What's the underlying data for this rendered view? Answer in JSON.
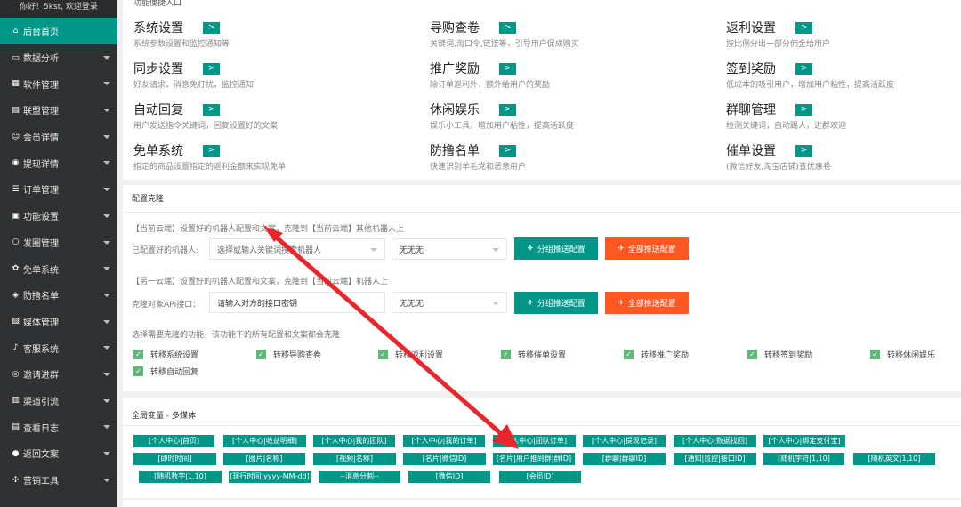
{
  "sidebar": {
    "greeting": "你好！5kst, 欢迎登录",
    "items": [
      {
        "label": "后台首页",
        "icon": "⌂"
      },
      {
        "label": "数据分析",
        "icon": "▭"
      },
      {
        "label": "软件管理",
        "icon": "▦"
      },
      {
        "label": "联盟管理",
        "icon": "▤"
      },
      {
        "label": "会员详情",
        "icon": "☺"
      },
      {
        "label": "提现详情",
        "icon": "◉"
      },
      {
        "label": "订单管理",
        "icon": "☰"
      },
      {
        "label": "功能设置",
        "icon": "▣"
      },
      {
        "label": "发圈管理",
        "icon": "○"
      },
      {
        "label": "免单系统",
        "icon": "✿"
      },
      {
        "label": "防撸名单",
        "icon": "◈"
      },
      {
        "label": "媒体管理",
        "icon": "▧"
      },
      {
        "label": "客服系统",
        "icon": "♪"
      },
      {
        "label": "邀请进群",
        "icon": "◎"
      },
      {
        "label": "渠道引流",
        "icon": "▥"
      },
      {
        "label": "查看日志",
        "icon": "▤"
      },
      {
        "label": "返回文案",
        "icon": "●"
      },
      {
        "label": "营销工具",
        "icon": "✣"
      }
    ]
  },
  "features": {
    "hint": "功能便捷入口",
    "items": [
      {
        "title": "系统设置",
        "desc": "系统参数设置和监控通知等"
      },
      {
        "title": "导购查卷",
        "desc": "关键词,淘口令,链接等，引导用户促成购买"
      },
      {
        "title": "返利设置",
        "desc": "按比例分出一部分佣金给用户"
      },
      {
        "title": "同步设置",
        "desc": "好友请求，消息免打扰，监控通知"
      },
      {
        "title": "推广奖励",
        "desc": "除订单返利外，额外给用户的奖励"
      },
      {
        "title": "签到奖励",
        "desc": "低成本的吸引用户，增加用户粘性，提高活跃度"
      },
      {
        "title": "自动回复",
        "desc": "用户发送指令关键词，回复设置好的文案"
      },
      {
        "title": "休闲娱乐",
        "desc": "娱乐小工具，增加用户粘性，提高活跃度"
      },
      {
        "title": "群聊管理",
        "desc": "检测关键词，自动踢人，进群欢迎"
      },
      {
        "title": "免单系统",
        "desc": "指定的商品设置指定的返利金额来实现免单"
      },
      {
        "title": "防撸名单",
        "desc": "快速识别羊毛党和恶意用户"
      },
      {
        "title": "催单设置",
        "desc": "(微信好友,淘宝店铺)查优惠卷"
      }
    ]
  },
  "clone": {
    "title": "配置克隆",
    "desc1": "【当前云端】设置好的机器人配置和文案，克隆到【当前云端】其他机器人上",
    "label1": "已配置好的机器人:",
    "select1_placeholder": "选择或输入关键词搜索机器人",
    "select2_value": "无无无",
    "btn_group": "分组推送配置",
    "btn_all": "全部推送配置",
    "desc2": "【另一云端】设置好的机器人配置和文案，克隆到【当前云端】机器人上",
    "label2": "克隆对象API接口：",
    "api_placeholder": "请输入对方的接口密钥",
    "select3_value": "无无无",
    "desc3": "选择需要克隆的功能，该功能下的所有配置和文案都会克隆",
    "checks": [
      "转移系统设置",
      "转移导购查卷",
      "转移返利设置",
      "转移催单设置",
      "转移推广奖励",
      "转移签到奖励",
      "转移休闲娱乐",
      "转移自动回复"
    ]
  },
  "vars": {
    "title": "全局变量 - 多媒体",
    "tags": [
      "[个人中心|首页]",
      "[个人中心|收益明细]",
      "[个人中心|我的团队]",
      "[个人中心|我的订单]",
      "[个人中心|团队订单]",
      "[个人中心|提现记录]",
      "[个人中心|数据找回]",
      "[个人中心|绑定支付宝]",
      "[即时时间]",
      "[图片|名称]",
      "[视频|名称]",
      "[名片|微信ID]",
      "[名片|用户推到群|群ID]",
      "[群聊|群聊ID]",
      "[通知|监控|接口ID]",
      "[随机字符|1,10]",
      "[随机英文|1,10]",
      "[随机数字|1,10]",
      "[现行时间|yyyy-MM-dd]",
      "--消息分割--",
      "[微信ID]",
      "[会员ID]"
    ]
  },
  "colors": {
    "accent": "#009688",
    "orange": "#ff5722",
    "sidebar": "#2f3133",
    "arrow": "#e8262b"
  }
}
